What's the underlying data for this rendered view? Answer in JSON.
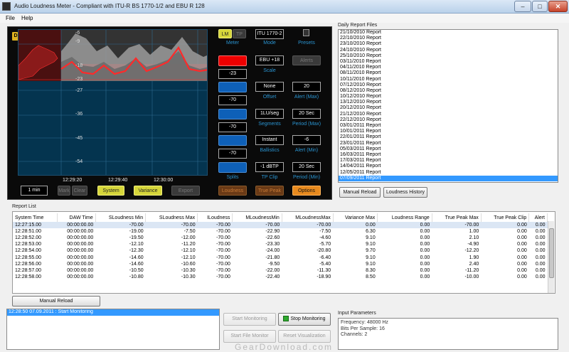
{
  "window": {
    "title": "Audio Loudness Meter - Compliant with ITU-R BS 1770-1/2 and EBU R 128",
    "minimize": "–",
    "maximize": "□",
    "close": "✕"
  },
  "menu": {
    "file": "File",
    "help": "Help"
  },
  "meter": {
    "badge": "D",
    "scale_labels": [
      "-6",
      "-9",
      "-18",
      "-23",
      "-27",
      "-36",
      "-45",
      "-54"
    ],
    "time_labels": [
      "12:29:20",
      "12:29:40",
      "12:30:00"
    ],
    "duration_value": "1 min",
    "buttons": {
      "mark": "Mark",
      "clear": "Clear",
      "system": "System",
      "variance": "Variance",
      "export": "Export"
    }
  },
  "controls": {
    "lm": "LM",
    "tp": "TP",
    "meter_label": "Meter",
    "mode_value": "ITU 1770-2",
    "mode_label": "Mode",
    "presets_label": "Presets",
    "target_value": "-23",
    "scale_value": "EBU +18",
    "scale_label": "Scale",
    "alerts_button": "Alerts",
    "offset_value": "-70",
    "offset_mode": "None",
    "offset_label": "Offset",
    "alert_max_value": "20",
    "alert_max_label": "Alert (Max)",
    "segments_box_value": "-70",
    "segments_value": "1LU/seg",
    "segments_label": "Segments",
    "period_max_value": "20 Sec",
    "period_max_label": "Period (Max)",
    "ballistics_box_value": "-70",
    "ballistics_value": "Instant",
    "ballistics_label": "Ballistics",
    "alert_min_value": "-6",
    "alert_min_label": "Alert (Min)",
    "splits_label": "Splits",
    "tp_clip_value": "-1 dBTP",
    "tp_clip_label": "TP Clip",
    "period_min_value": "20 Sec",
    "period_min_label": "Period (Min)",
    "loudness_button": "Loudness",
    "true_peak_button": "True Peak",
    "options_button": "Options"
  },
  "daily_reports": {
    "title": "Daily Report Files",
    "files": [
      "21/10/2010 Report",
      "22/10/2010 Report",
      "23/10/2010 Report",
      "24/10/2010 Report",
      "25/10/2010 Report",
      "03/11/2010 Report",
      "04/11/2010 Report",
      "08/11/2010 Report",
      "10/11/2010 Report",
      "07/12/2010 Report",
      "08/12/2010 Report",
      "10/12/2010 Report",
      "13/12/2010 Report",
      "20/12/2010 Report",
      "21/12/2010 Report",
      "22/12/2010 Report",
      "03/01/2011 Report",
      "10/01/2011 Report",
      "22/01/2011 Report",
      "23/01/2011 Report",
      "05/03/2011 Report",
      "16/03/2011 Report",
      "17/03/2011 Report",
      "14/04/2011 Report",
      "12/05/2011 Report",
      "07/09/2011 Report"
    ],
    "manual_reload": "Manual Reload",
    "loudness_history": "Loudness History"
  },
  "report_list": {
    "title": "Report List",
    "columns": [
      "System Time",
      "DAW Time",
      "SLoudness Min",
      "SLoudness Max",
      "ILoudness",
      "MLoudnessMin",
      "MLoudnessMax",
      "Variance Max",
      "Loudness Range",
      "True Peak Max",
      "True Peak Clip",
      "Alert"
    ],
    "rows": [
      [
        "12:27:15.00",
        "00:00:00.00",
        "-70.00",
        "-70.00",
        "-70.00",
        "-70.00",
        "-70.00",
        "0.00",
        "0.00",
        "-70.00",
        "0.00",
        "0.00"
      ],
      [
        "12:28:51.00",
        "00:00:00.00",
        "-19.00",
        "-7.50",
        "-70.00",
        "-22.90",
        "-7.50",
        "6.30",
        "0.00",
        "1.00",
        "0.00",
        "0.00"
      ],
      [
        "12:28:52.00",
        "00:00:00.00",
        "-19.50",
        "-12.00",
        "-70.00",
        "-22.60",
        "-4.60",
        "9.10",
        "0.00",
        "2.10",
        "0.00",
        "0.00"
      ],
      [
        "12:28:53.00",
        "00:00:00.00",
        "-12.10",
        "-11.20",
        "-70.00",
        "-23.30",
        "-5.70",
        "9.10",
        "0.00",
        "-4.90",
        "0.00",
        "0.00"
      ],
      [
        "12:28:54.00",
        "00:00:00.00",
        "-12.30",
        "-12.10",
        "-70.00",
        "-24.00",
        "-20.80",
        "9.70",
        "0.00",
        "-12.20",
        "0.00",
        "0.00"
      ],
      [
        "12:28:55.00",
        "00:00:00.00",
        "-14.60",
        "-12.10",
        "-70.00",
        "-21.80",
        "-6.40",
        "9.10",
        "0.00",
        "1.90",
        "0.00",
        "0.00"
      ],
      [
        "12:28:56.00",
        "00:00:00.00",
        "-14.60",
        "-10.60",
        "-70.00",
        "-9.50",
        "-5.40",
        "9.10",
        "0.00",
        "2.40",
        "0.00",
        "0.00"
      ],
      [
        "12:28:57.00",
        "00:00:00.00",
        "-10.50",
        "-10.30",
        "-70.00",
        "-22.00",
        "-11.30",
        "8.30",
        "0.00",
        "-11.20",
        "0.00",
        "0.00"
      ],
      [
        "12:28:58.00",
        "00:00:00.00",
        "-10.80",
        "-10.30",
        "-70.00",
        "-22.40",
        "-18.90",
        "8.50",
        "0.00",
        "-10.00",
        "0.00",
        "0.00"
      ]
    ],
    "manual_reload": "Manual Reload"
  },
  "log": {
    "entries": [
      "12:28:50  07.09.2011 : Start Monitoring"
    ]
  },
  "system_buttons": {
    "start_monitoring": "Start Monitoring",
    "stop_monitoring": "Stop Monitoring",
    "start_file_monitor": "Start File Monitor",
    "reset_visualization": "Reset Visualization"
  },
  "input_parameters": {
    "title": "Input Parameters",
    "lines": [
      "Frequency: 48000 Hz",
      "Bits Per Sample: 16",
      "Channels: 2"
    ]
  },
  "watermark": "GearDownload.com",
  "colors": {
    "meter_bg": "#04344f",
    "red_band": "#cc1111",
    "accent_blue": "#3399ff",
    "button_yellow": "#d6d63a",
    "button_orange": "#e88a1e"
  }
}
